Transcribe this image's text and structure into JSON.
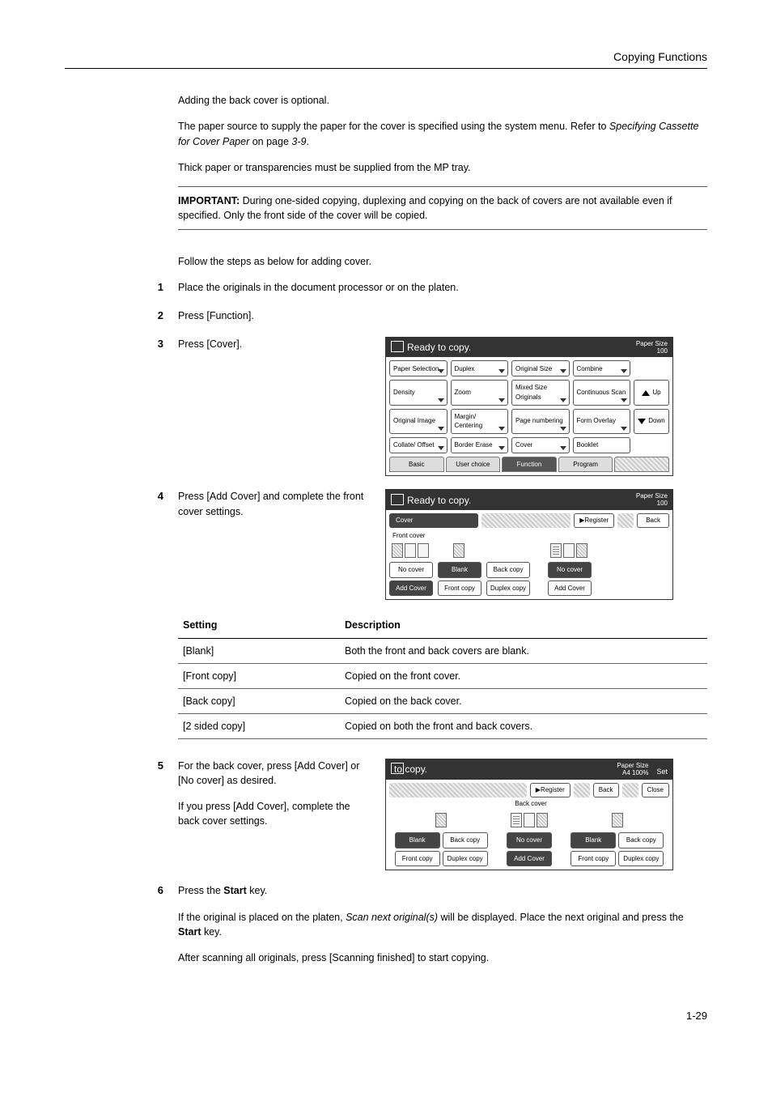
{
  "header": {
    "title": "Copying Functions"
  },
  "intro": {
    "p1": "Adding the back cover is optional.",
    "p2a": "The paper source to supply the paper for the cover is specified using the system menu. Refer to ",
    "p2b": "Specifying Cassette for Cover Paper",
    "p2c": " on page ",
    "p2d": "3-9",
    "p2e": ".",
    "p3": "Thick paper or transparencies must be supplied from the MP tray."
  },
  "important": {
    "label": "IMPORTANT:",
    "text": " During one-sided copying, duplexing and copying on the back of covers are not available even if specified. Only the front side of the cover will be copied."
  },
  "follow": "Follow the steps as below for adding cover.",
  "steps": {
    "s1": {
      "n": "1",
      "t": "Place the originals in the document processor or on the platen."
    },
    "s2": {
      "n": "2",
      "t": "Press [Function]."
    },
    "s3": {
      "n": "3",
      "t": "Press [Cover]."
    },
    "s4": {
      "n": "4",
      "t": "Press [Add Cover] and complete the front cover settings."
    },
    "s5": {
      "n": "5",
      "t1": "For the back cover, press [Add Cover] or [No cover] as desired.",
      "t2": "If you press [Add Cover], complete the back cover settings."
    },
    "s6": {
      "n": "6",
      "l1a": "Press the ",
      "l1b": "Start",
      "l1c": " key.",
      "l2a": "If the original is placed on the platen, ",
      "l2b": "Scan next original(s)",
      "l2c": " will be displayed. Place the next original and press the ",
      "l2d": "Start",
      "l2e": " key.",
      "l3": "After scanning all originals, press [Scanning finished] to start copying."
    }
  },
  "panel1": {
    "title": "Ready to copy.",
    "paper_size_label": "Paper Size",
    "paper_size_val": "100",
    "buttons": {
      "paper_selection": "Paper\nSelection",
      "duplex": "Duplex",
      "original_size": "Original\nSize",
      "combine": "Combine",
      "density": "Density",
      "zoom": "Zoom",
      "mixed": "Mixed Size\nOriginals",
      "cont": "Continuous\nScan",
      "orig_image": "Original\nImage",
      "margin": "Margin/\nCentering",
      "page_num": "Page\nnumbering",
      "form": "Form\nOverlay",
      "collate": "Collate/\nOffset",
      "border": "Border\nErase",
      "cover": "Cover",
      "booklet": "Booklet",
      "up": "Up",
      "down": "Down"
    },
    "tabs": {
      "basic": "Basic",
      "user": "User choice",
      "func": "Function",
      "prog": "Program"
    }
  },
  "panel2": {
    "title": "Ready to copy.",
    "paper_size_label": "Paper Size",
    "paper_size_val": "100",
    "cover_label": "Cover",
    "register": "Register",
    "back": "Back",
    "front_cover": "Front cover",
    "btns": {
      "nocover": "No cover",
      "blank": "Blank",
      "backcopy": "Back copy",
      "nocover2": "No cover",
      "addcover": "Add Cover",
      "frontcopy": "Front copy",
      "duplex": "Duplex\ncopy",
      "addcover2": "Add Cover"
    }
  },
  "table": {
    "h1": "Setting",
    "h2": "Description",
    "rows": [
      {
        "s": "[Blank]",
        "d": "Both the front and back covers are blank."
      },
      {
        "s": "[Front copy]",
        "d": "Copied on the front cover."
      },
      {
        "s": "[Back copy]",
        "d": "Copied on the back cover."
      },
      {
        "s": "[2 sided copy]",
        "d": "Copied on both the front and back covers."
      }
    ]
  },
  "panel3": {
    "title": "to copy.",
    "paper_size_label": "Paper Size",
    "paper_size_val": "A4\n100%",
    "set": "Set",
    "register": "Register",
    "back": "Back",
    "close": "Close",
    "back_cover": "Back cover",
    "btns": {
      "blank": "Blank",
      "backcopy": "Back copy",
      "nocover": "No cover",
      "blank2": "Blank",
      "backcopy2": "Back copy",
      "frontcopy": "Front copy",
      "duplex": "Duplex\ncopy",
      "addcover": "Add Cover",
      "frontcopy2": "Front copy",
      "duplex2": "Duplex\ncopy"
    }
  },
  "page_number": "1-29",
  "chart_data": null
}
